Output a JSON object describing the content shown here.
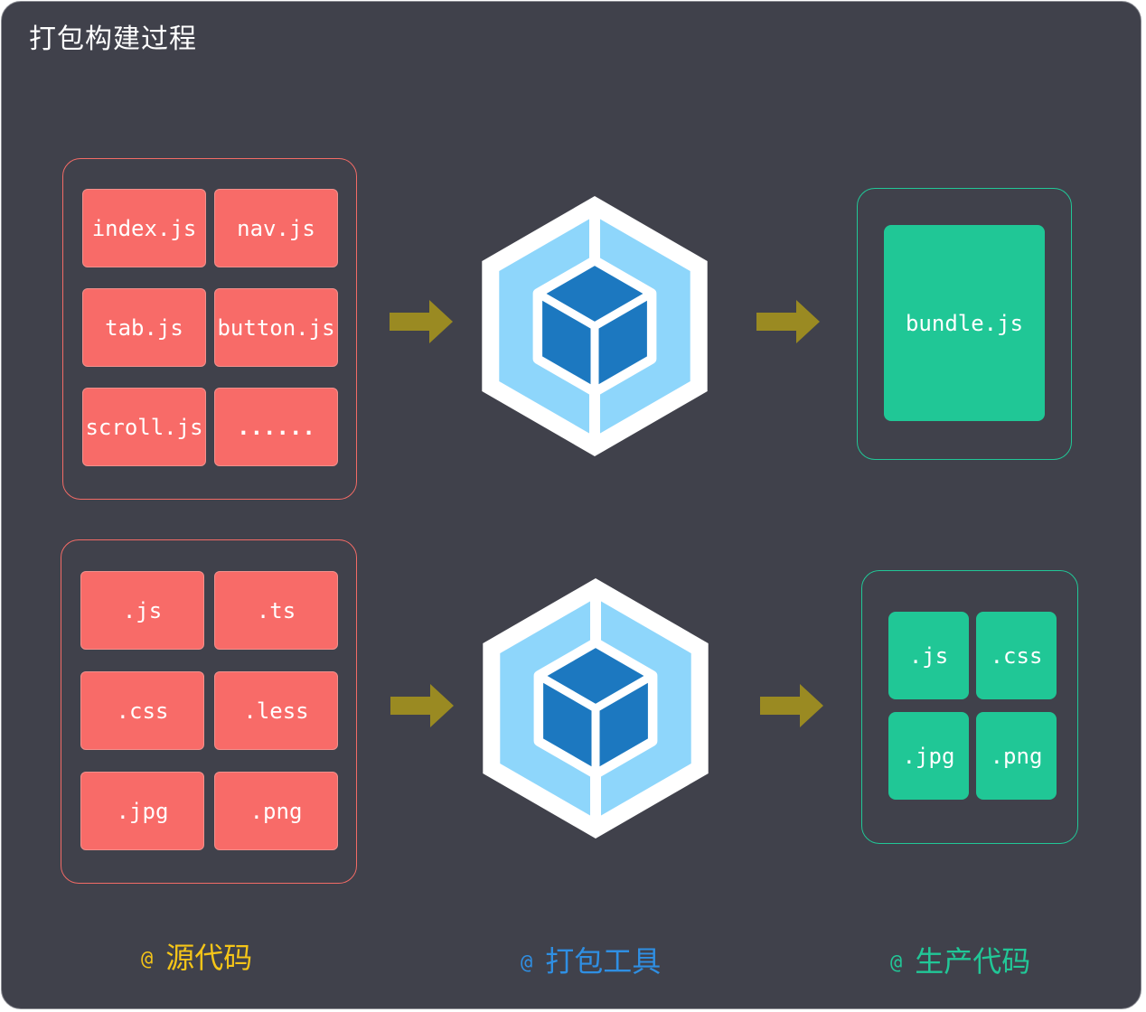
{
  "title": "打包构建过程",
  "rows": [
    {
      "source_tiles": [
        "index.js",
        "nav.js",
        "tab.js",
        "button.js",
        "scroll.js",
        "......"
      ],
      "output_tiles": [
        "bundle.js"
      ]
    },
    {
      "source_tiles": [
        ".js",
        ".ts",
        ".css",
        ".less",
        ".jpg",
        ".png"
      ],
      "output_tiles": [
        ".js",
        ".css",
        ".jpg",
        ".png"
      ]
    }
  ],
  "captions": [
    {
      "at": "@",
      "label": "源代码",
      "color": "#f5c518"
    },
    {
      "at": "@",
      "label": "打包工具",
      "color": "#2f8fe3"
    },
    {
      "at": "@",
      "label": "生产代码",
      "color": "#21c797"
    }
  ],
  "colors": {
    "background": "#40414b",
    "source_tile": "#f86b68",
    "output_tile": "#20c796",
    "arrow": "#9a8a22",
    "hex_outer": "#ffffff",
    "hex_light": "#8ed6fb",
    "hex_dark": "#1c78c0"
  },
  "icons": [
    "webpack-logo-icon",
    "right-arrow-icon"
  ]
}
